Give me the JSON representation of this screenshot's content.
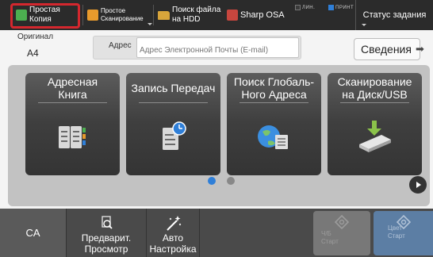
{
  "top_bar": {
    "tabs": [
      {
        "line1": "Простая",
        "line2": "Копия",
        "icon": "copy-icon"
      },
      {
        "line1": "Простое",
        "line2": "Сканирование",
        "icon": "scan-icon"
      },
      {
        "line1": "Поиск файла",
        "line2": "на HDD",
        "icon": "folder-icon"
      },
      {
        "line1": "Sharp OSA",
        "icon": "osa-icon"
      }
    ],
    "indicators": [
      {
        "label": "ЛИН.",
        "color": "#3a3a3a"
      },
      {
        "label": "ПРИНТ",
        "color": "#2f7fd8"
      }
    ],
    "status_label": "Статус задания"
  },
  "original": {
    "label": "Оригинал",
    "value": "A4"
  },
  "address": {
    "label": "Адрес",
    "placeholder": "Адрес Электронной Почты (E-mail)"
  },
  "details_label": "Сведения",
  "tiles": [
    {
      "line1": "Адресная",
      "line2": "Книга",
      "icon": "address-book-icon"
    },
    {
      "line1": "Запись Передач",
      "line2": "",
      "icon": "transmission-log-icon"
    },
    {
      "line1": "Поиск Глобаль-",
      "line2": "Ного Адреса",
      "icon": "global-address-icon"
    },
    {
      "line1": "Сканирование",
      "line2": "на Диск/USB",
      "icon": "usb-disk-icon"
    }
  ],
  "pagination": {
    "current_page": 1,
    "total_pages": 2
  },
  "bottom_bar": {
    "ca_label": "CA",
    "preview": {
      "line1": "Предварит.",
      "line2": "Просмотр"
    },
    "auto_setting": {
      "line1": "Авто",
      "line2": "Настройка"
    },
    "mono_start": {
      "line1": "Ч/Б",
      "line2": "Старт"
    },
    "color_start": {
      "line1": "Цвет",
      "line2": "Старт"
    }
  },
  "colors": {
    "highlight": "#d4272e",
    "accent_blue": "#2f7fd8",
    "top_bar": "#2b2b2b",
    "tile": "#3f3f3f"
  }
}
